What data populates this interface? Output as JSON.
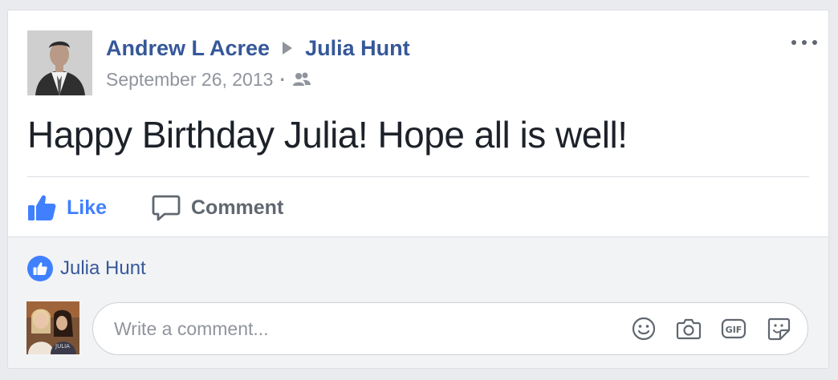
{
  "post": {
    "author": "Andrew L Acree",
    "recipient": "Julia Hunt",
    "date": "September 26, 2013",
    "audience_icon": "friends-icon",
    "text": "Happy Birthday Julia! Hope all is well!"
  },
  "actions": {
    "like_label": "Like",
    "comment_label": "Comment"
  },
  "reactions": {
    "likers": "Julia Hunt"
  },
  "comment_input": {
    "placeholder": "Write a comment...",
    "tools": [
      "emoji-icon",
      "camera-icon",
      "gif-icon",
      "sticker-icon"
    ]
  },
  "colors": {
    "link": "#365899",
    "like_blue": "#4080ff",
    "meta_gray": "#90949c"
  }
}
